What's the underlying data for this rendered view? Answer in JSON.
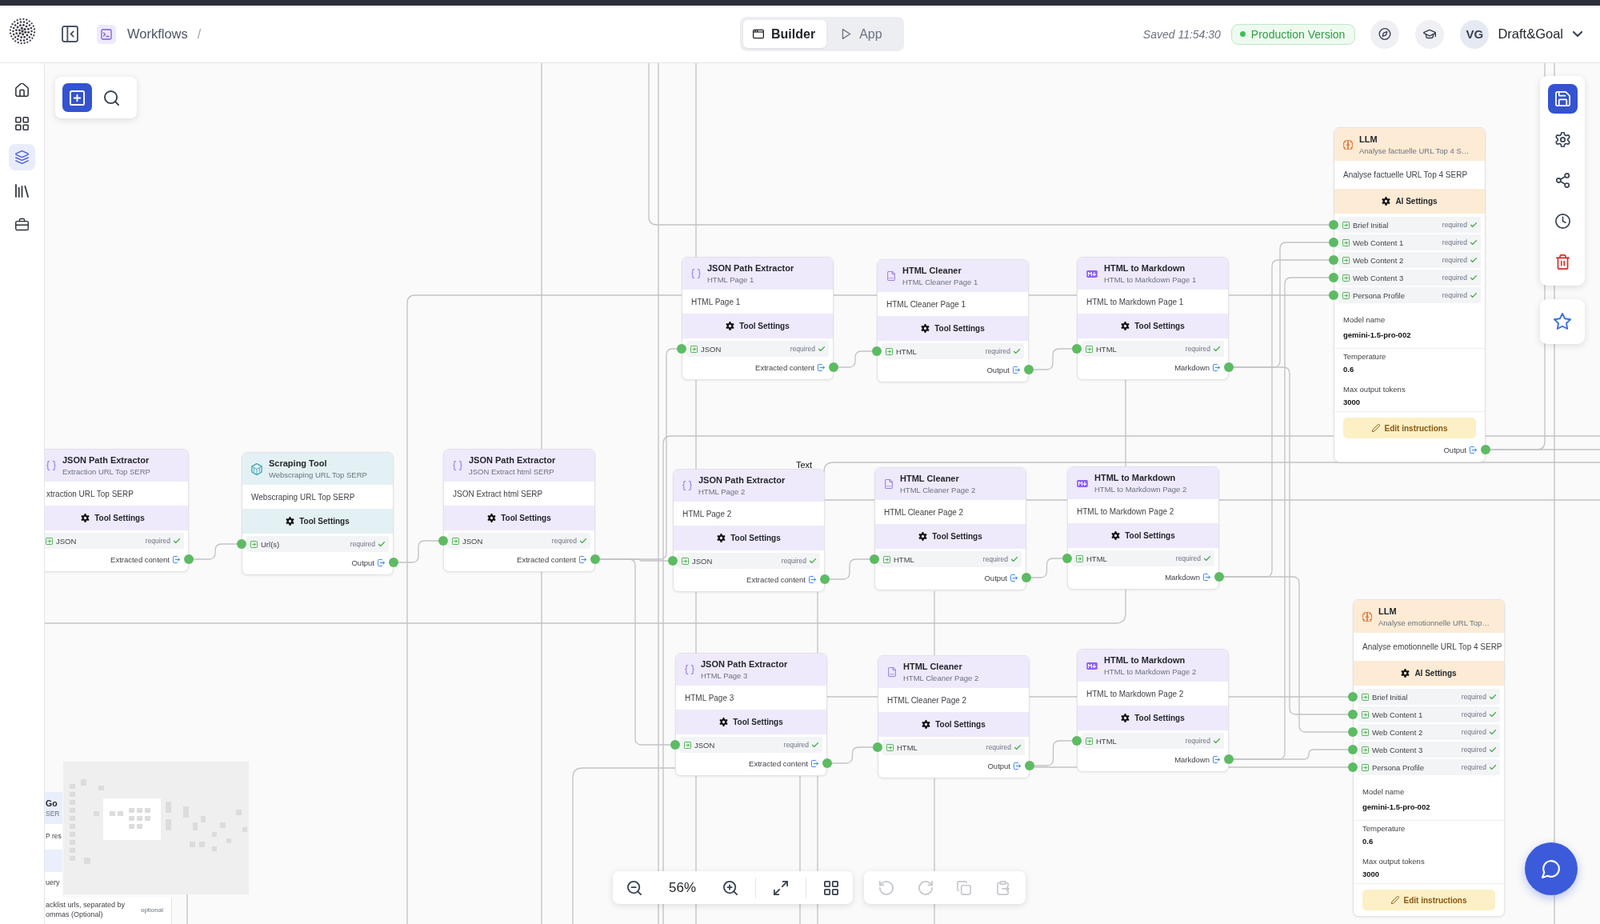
{
  "top_bar": {
    "breadcrumb_label": "Workflows",
    "breadcrumb_separator": "/",
    "mode_tabs": [
      {
        "label": "Builder",
        "selected": true
      },
      {
        "label": "App",
        "selected": false
      }
    ],
    "save_status": "Saved 11:54:30",
    "version_badge": "Production Version",
    "user": {
      "initials": "VG",
      "name": "Draft&Goal"
    }
  },
  "sidebar": {
    "items": [
      {
        "selected": false
      },
      {
        "selected": false
      },
      {
        "selected": true
      },
      {
        "selected": false
      },
      {
        "selected": false
      }
    ]
  },
  "canvas": {
    "nodes": [
      {
        "kind": "llm",
        "title": "LLM",
        "subtitle": "Analyse factuelle URL Top 4 S…",
        "description": "Analyse factuelle URL Top 4 SERP",
        "settings_label": "AI Settings",
        "inputs": [
          {
            "label": "Brief Initial",
            "badge": "required",
            "satisfied": true
          },
          {
            "label": "Web Content 1",
            "badge": "required",
            "satisfied": true
          },
          {
            "label": "Web Content 2",
            "badge": "required",
            "satisfied": true
          },
          {
            "label": "Web Content 3",
            "badge": "required",
            "satisfied": true
          },
          {
            "label": "Persona Profile",
            "badge": "required",
            "satisfied": true
          }
        ],
        "model": {
          "label": "Model name",
          "value": "gemini-1.5-pro-002"
        },
        "parameters": [
          {
            "label": "Temperature",
            "value": "0.6"
          },
          {
            "label": "Max output tokens",
            "value": "3000"
          }
        ],
        "action": "Edit instructions",
        "outputs": [
          {
            "label": "Output"
          }
        ]
      },
      {
        "kind": "json_path",
        "title": "JSON Path Extractor",
        "subtitle": "HTML Page 1",
        "description": "HTML Page 1",
        "settings_label": "Tool Settings",
        "inputs": [
          {
            "label": "JSON",
            "badge": "required",
            "satisfied": true
          }
        ],
        "outputs": [
          {
            "label": "Extracted content"
          }
        ]
      },
      {
        "kind": "html_cleaner",
        "title": "HTML Cleaner",
        "subtitle": "HTML Cleaner Page 1",
        "description": "HTML Cleaner Page 1",
        "settings_label": "Tool Settings",
        "inputs": [
          {
            "label": "HTML",
            "badge": "required",
            "satisfied": true
          }
        ],
        "outputs": [
          {
            "label": "Output"
          }
        ]
      },
      {
        "kind": "html_to_markdown",
        "title": "HTML to Markdown",
        "subtitle": "HTML to Markdown Page 1",
        "description": "HTML to Markdown Page 1",
        "settings_label": "Tool Settings",
        "inputs": [
          {
            "label": "HTML",
            "badge": "required",
            "satisfied": true
          }
        ],
        "outputs": [
          {
            "label": "Markdown"
          }
        ]
      },
      {
        "kind": "json_path",
        "title": "JSON Path Extractor",
        "subtitle": "Extraction URL Top SERP",
        "description": "xtraction URL Top SERP",
        "settings_label": "Tool Settings",
        "inputs": [
          {
            "label": "JSON",
            "badge": "required",
            "satisfied": true
          }
        ],
        "outputs": [
          {
            "label": "Extracted content"
          }
        ]
      },
      {
        "kind": "scraper",
        "title": "Scraping Tool",
        "subtitle": "Webscraping URL Top SERP",
        "description": "Webscraping URL Top SERP",
        "settings_label": "Tool Settings",
        "inputs": [
          {
            "label": "Url(s)",
            "badge": "required",
            "satisfied": true
          }
        ],
        "outputs": [
          {
            "label": "Output"
          }
        ]
      },
      {
        "kind": "json_path",
        "title": "JSON Path Extractor",
        "subtitle": "JSON Extract html SERP",
        "description": "JSON Extract html SERP",
        "settings_label": "Tool Settings",
        "inputs": [
          {
            "label": "JSON",
            "badge": "required",
            "satisfied": true
          }
        ],
        "outputs": [
          {
            "label": "Extracted content"
          }
        ]
      },
      {
        "kind": "json_path",
        "title": "JSON Path Extractor",
        "subtitle": "HTML Page 2",
        "description": "HTML Page 2",
        "settings_label": "Tool Settings",
        "inputs": [
          {
            "label": "JSON",
            "badge": "required",
            "satisfied": true
          }
        ],
        "outputs": [
          {
            "label": "Extracted content"
          }
        ]
      },
      {
        "kind": "html_cleaner",
        "title": "HTML Cleaner",
        "subtitle": "HTML Cleaner Page 2",
        "description": "HTML Cleaner Page 2",
        "settings_label": "Tool Settings",
        "inputs": [
          {
            "label": "HTML",
            "badge": "required",
            "satisfied": true
          }
        ],
        "outputs": [
          {
            "label": "Output"
          }
        ]
      },
      {
        "kind": "html_to_markdown",
        "title": "HTML to Markdown",
        "subtitle": "HTML to Markdown Page 2",
        "description": "HTML to Markdown Page 2",
        "settings_label": "Tool Settings",
        "inputs": [
          {
            "label": "HTML",
            "badge": "required",
            "satisfied": true
          }
        ],
        "outputs": [
          {
            "label": "Markdown"
          }
        ]
      },
      {
        "kind": "llm",
        "title": "LLM",
        "subtitle": "Analyse emotionnelle URL Top…",
        "description": "Analyse emotionnelle URL Top 4 SERP",
        "settings_label": "AI Settings",
        "inputs": [
          {
            "label": "Brief Initial",
            "badge": "required",
            "satisfied": true
          },
          {
            "label": "Web Content 1",
            "badge": "required",
            "satisfied": true
          },
          {
            "label": "Web Content 2",
            "badge": "required",
            "satisfied": true
          },
          {
            "label": "Web Content 3",
            "badge": "required",
            "satisfied": true
          },
          {
            "label": "Persona Profile",
            "badge": "required",
            "satisfied": true
          }
        ],
        "model": {
          "label": "Model name",
          "value": "gemini-1.5-pro-002"
        },
        "parameters": [
          {
            "label": "Temperature",
            "value": "0.6"
          },
          {
            "label": "Max output tokens",
            "value": "3000"
          }
        ],
        "action": "Edit instructions"
      },
      {
        "kind": "json_path",
        "title": "JSON Path Extractor",
        "subtitle": "HTML Page 3",
        "description": "HTML Page 3",
        "settings_label": "Tool Settings",
        "inputs": [
          {
            "label": "JSON",
            "badge": "required",
            "satisfied": true
          }
        ],
        "outputs": [
          {
            "label": "Extracted content"
          }
        ]
      },
      {
        "kind": "html_cleaner",
        "title": "HTML Cleaner",
        "subtitle": "HTML Cleaner Page 2",
        "description": "HTML Cleaner Page 2",
        "settings_label": "Tool Settings",
        "inputs": [
          {
            "label": "HTML",
            "badge": "required",
            "satisfied": true
          }
        ],
        "outputs": [
          {
            "label": "Output"
          }
        ]
      },
      {
        "kind": "html_to_markdown",
        "title": "HTML to Markdown",
        "subtitle": "HTML to Markdown Page 2",
        "description": "HTML to Markdown Page 2",
        "settings_label": "Tool Settings",
        "inputs": [
          {
            "label": "HTML",
            "badge": "required",
            "satisfied": true
          }
        ],
        "outputs": [
          {
            "label": "Markdown"
          }
        ]
      }
    ],
    "edge_label": "Text",
    "partial_node": {
      "title": "Go",
      "subtitle": "SER",
      "description": "P res",
      "inputs": [
        {
          "label": "uery"
        },
        {
          "label": "acklist urls, separated by ommas (Optional)",
          "badge": "optional"
        }
      ]
    }
  },
  "zoom_controls": {
    "value": "56%"
  },
  "edit_actions": [
    {
      "disabled": true
    },
    {
      "disabled": true
    },
    {
      "disabled": true
    },
    {
      "disabled": true
    }
  ]
}
